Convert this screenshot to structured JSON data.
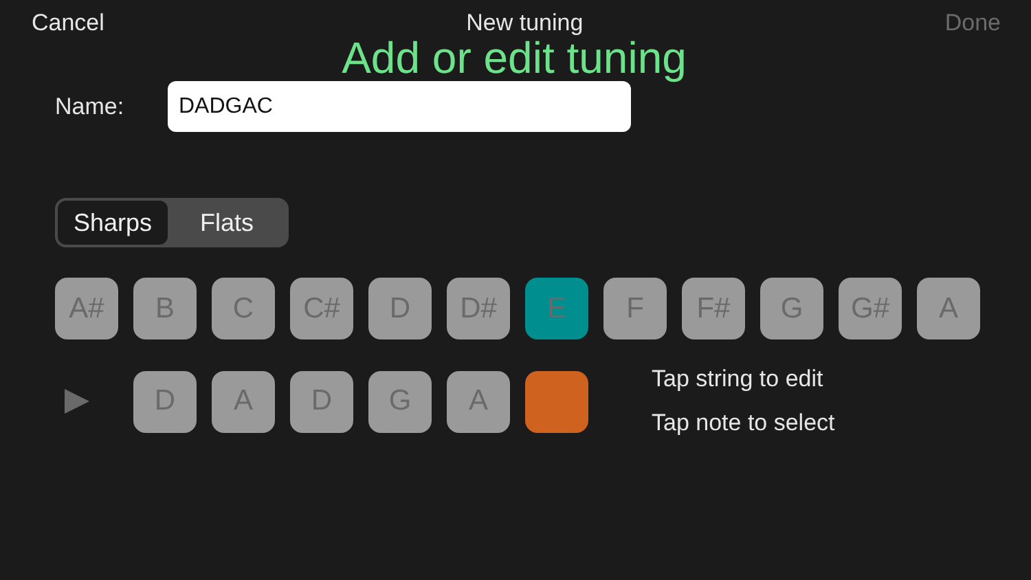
{
  "nav": {
    "cancel": "Cancel",
    "title": "New tuning",
    "done": "Done",
    "done_disabled": true
  },
  "headline": "Add or edit tuning",
  "name_field": {
    "label": "Name:",
    "value": "DADGAC"
  },
  "accidentals": [
    {
      "label": "Sharps",
      "selected": true
    },
    {
      "label": "Flats",
      "selected": false
    }
  ],
  "notes": [
    {
      "label": "A#",
      "selected": false
    },
    {
      "label": "B",
      "selected": false
    },
    {
      "label": "C",
      "selected": false
    },
    {
      "label": "C#",
      "selected": false
    },
    {
      "label": "D",
      "selected": false
    },
    {
      "label": "D#",
      "selected": false
    },
    {
      "label": "E",
      "selected": true
    },
    {
      "label": "F",
      "selected": false
    },
    {
      "label": "F#",
      "selected": false
    },
    {
      "label": "G",
      "selected": false
    },
    {
      "label": "G#",
      "selected": false
    },
    {
      "label": "A",
      "selected": false
    }
  ],
  "strings": [
    {
      "note": "D",
      "selected": false
    },
    {
      "note": "A",
      "selected": false
    },
    {
      "note": "D",
      "selected": false
    },
    {
      "note": "G",
      "selected": false
    },
    {
      "note": "A",
      "selected": false
    },
    {
      "selected": true
    }
  ],
  "hints": [
    "Tap string to edit",
    "Tap note to select"
  ]
}
